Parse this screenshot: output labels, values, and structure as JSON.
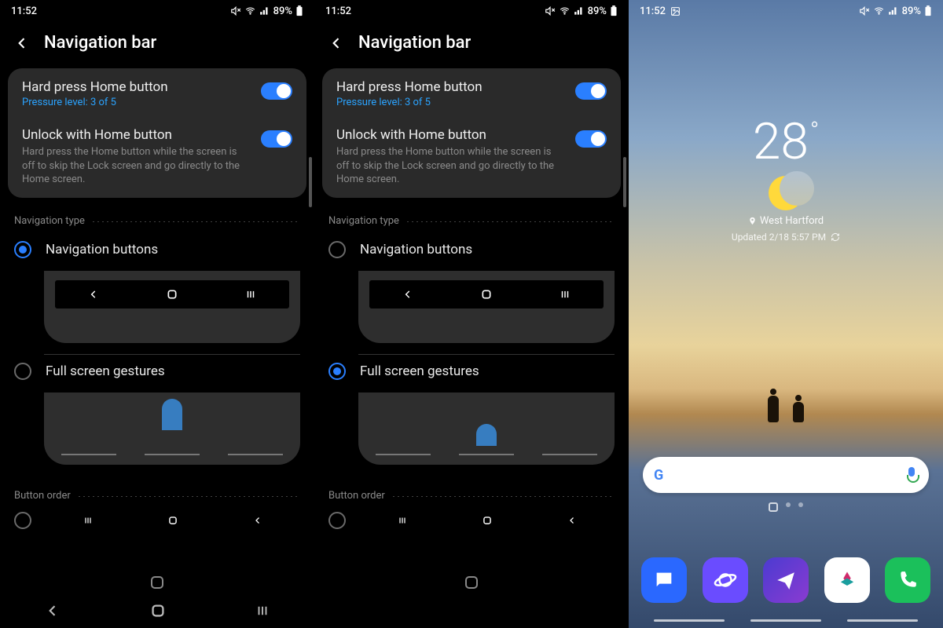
{
  "status": {
    "time": "11:52",
    "battery": "89%"
  },
  "settings": {
    "title": "Navigation bar",
    "hardPress": {
      "label": "Hard press Home button",
      "sub": "Pressure level: 3 of 5"
    },
    "unlock": {
      "label": "Unlock with Home button",
      "sub": "Hard press the Home button while the screen is off to skip the Lock screen and go directly to the Home screen."
    },
    "sectionNavType": "Navigation type",
    "optButtons": "Navigation buttons",
    "optGestures": "Full screen gestures",
    "sectionOrder": "Button order"
  },
  "screens": {
    "left": {
      "selected": "buttons"
    },
    "middle": {
      "selected": "gestures"
    }
  },
  "home": {
    "temp": "28",
    "location": "West Hartford",
    "updated": "Updated 2/18 5:57 PM"
  }
}
